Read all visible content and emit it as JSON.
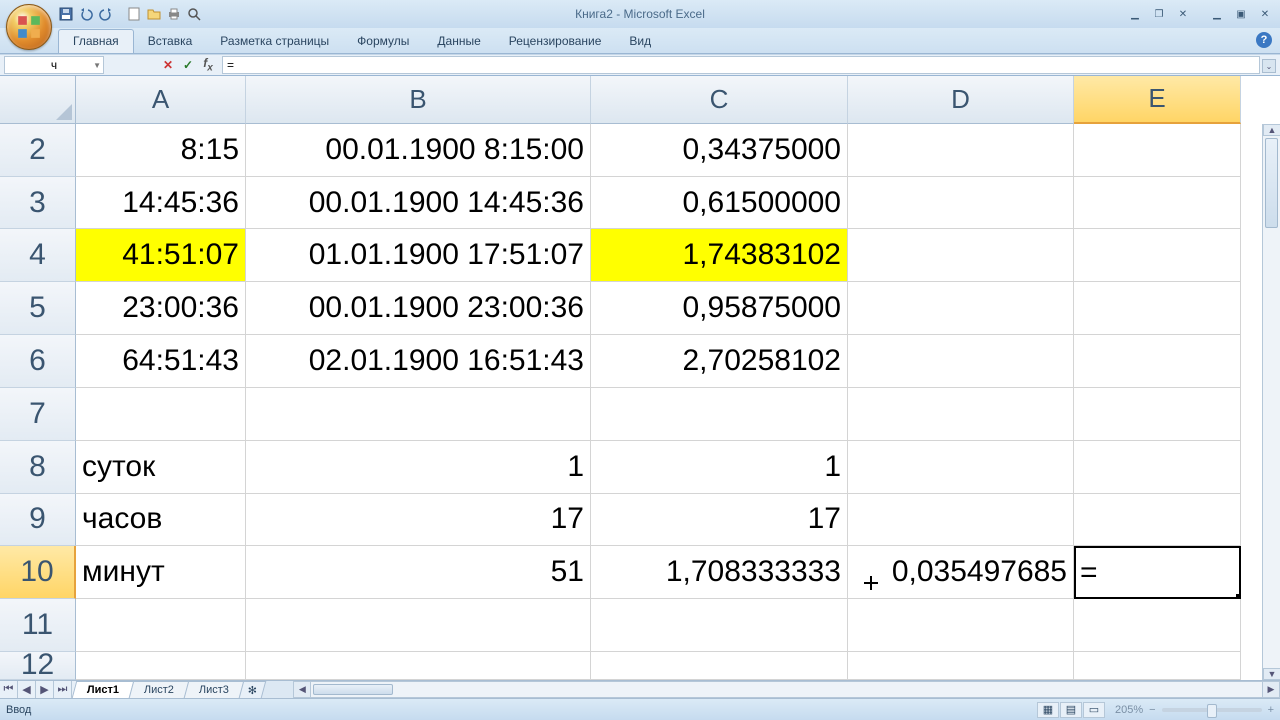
{
  "title": "Книга2 - Microsoft Excel",
  "qat_icons": [
    "save-icon",
    "undo-icon",
    "redo-icon",
    "new-icon",
    "open-icon",
    "quick-print-icon",
    "print-preview-icon"
  ],
  "ribbon": {
    "tabs": [
      "Главная",
      "Вставка",
      "Разметка страницы",
      "Формулы",
      "Данные",
      "Рецензирование",
      "Вид"
    ],
    "active": 0
  },
  "name_box": "ч",
  "formula_bar": "=",
  "columns": [
    "A",
    "B",
    "C",
    "D",
    "E"
  ],
  "active_col": "E",
  "rows": [
    "2",
    "3",
    "4",
    "5",
    "6",
    "7",
    "8",
    "9",
    "10",
    "11",
    "12"
  ],
  "active_row": "10",
  "highlight_row": "4",
  "highlight_cols": [
    "A",
    "C"
  ],
  "cells": {
    "2": {
      "A": "8:15",
      "B": "00.01.1900 8:15:00",
      "C": "0,34375000",
      "D": "",
      "E": ""
    },
    "3": {
      "A": "14:45:36",
      "B": "00.01.1900 14:45:36",
      "C": "0,61500000",
      "D": "",
      "E": ""
    },
    "4": {
      "A": "41:51:07",
      "B": "01.01.1900 17:51:07",
      "C": "1,74383102",
      "D": "",
      "E": ""
    },
    "5": {
      "A": "23:00:36",
      "B": "00.01.1900 23:00:36",
      "C": "0,95875000",
      "D": "",
      "E": ""
    },
    "6": {
      "A": "64:51:43",
      "B": "02.01.1900 16:51:43",
      "C": "2,70258102",
      "D": "",
      "E": ""
    },
    "7": {
      "A": "",
      "B": "",
      "C": "",
      "D": "",
      "E": ""
    },
    "8": {
      "A": "суток",
      "B": "1",
      "C": "1",
      "D": "",
      "E": ""
    },
    "9": {
      "A": "часов",
      "B": "17",
      "C": "17",
      "D": "",
      "E": ""
    },
    "10": {
      "A": "минут",
      "B": "51",
      "C": "1,708333333",
      "D": "0,035497685",
      "E": "="
    },
    "11": {
      "A": "",
      "B": "",
      "C": "",
      "D": "",
      "E": ""
    },
    "12": {
      "A": "",
      "B": "",
      "C": "",
      "D": "",
      "E": ""
    }
  },
  "left_align": {
    "8": {
      "A": true
    },
    "9": {
      "A": true
    },
    "10": {
      "A": true
    }
  },
  "editing_cell": {
    "row": "10",
    "col": "E"
  },
  "sheets": {
    "tabs": [
      "Лист1",
      "Лист2",
      "Лист3"
    ],
    "active": 0
  },
  "status": "Ввод",
  "zoom": "205%"
}
